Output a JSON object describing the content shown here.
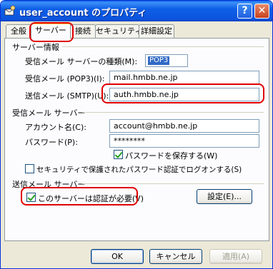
{
  "window": {
    "title": "user_account のプロパティ",
    "help_glyph": "?",
    "close_glyph": "✕"
  },
  "tabs": [
    {
      "label": "全般",
      "active": false
    },
    {
      "label": "サーバー",
      "active": true
    },
    {
      "label": "接続",
      "active": false
    },
    {
      "label": "セキュリティ",
      "active": false
    },
    {
      "label": "詳細設定",
      "active": false
    }
  ],
  "server_info": {
    "heading": "サーバー情報",
    "incoming_type_label": "受信メール サーバーの種類(M):",
    "incoming_type_value": "POP3",
    "incoming_pop3_label": "受信メール (POP3)(I):",
    "incoming_pop3_value": "mail.hmbb.ne.jp",
    "outgoing_smtp_label": "送信メール (SMTP)(U):",
    "outgoing_smtp_value": "auth.hmbb.ne.jp"
  },
  "incoming_server": {
    "heading": "受信メール サーバー",
    "account_label": "アカウント名(C):",
    "account_value": "account@hmbb.ne.jp",
    "password_label": "パスワード(P):",
    "password_value": "********",
    "save_password_label": "パスワードを保存する(W)",
    "save_password_checked": true,
    "spa_label": "セキュリティで保護されたパスワード認証でログオンする(S)",
    "spa_checked": false
  },
  "outgoing_server": {
    "heading": "送信メール サーバー",
    "auth_required_label": "このサーバーは認証が必要(V)",
    "auth_required_checked": true,
    "settings_button": "設定(E)..."
  },
  "footer": {
    "ok": "OK",
    "cancel": "キャンセル",
    "apply": "適用(A)"
  },
  "colors": {
    "highlight": "#e00000",
    "titlebar": "#0b55de",
    "dialog_bg": "#ece9d8"
  }
}
